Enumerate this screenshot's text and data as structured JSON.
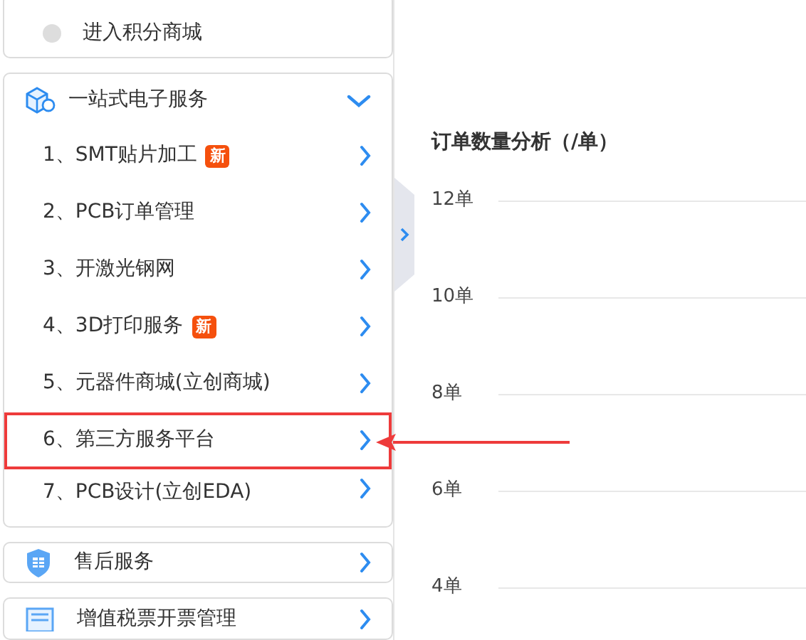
{
  "points_card": {
    "label": "进入积分商城"
  },
  "service_panel": {
    "title": "一站式电子服务",
    "expanded": true,
    "items": [
      {
        "label": "1、SMT贴片加工",
        "badge": "新",
        "highlighted": false
      },
      {
        "label": "2、PCB订单管理",
        "highlighted": false
      },
      {
        "label": "3、开激光钢网",
        "highlighted": false
      },
      {
        "label": "4、3D打印服务",
        "badge": "新",
        "highlighted": false
      },
      {
        "label": "5、元器件商城(立创商城)",
        "highlighted": false
      },
      {
        "label": "6、第三方服务平台",
        "highlighted": true
      },
      {
        "label": "7、PCB设计(立创EDA)",
        "highlighted": false
      }
    ]
  },
  "menu_cards": [
    {
      "kind": "after-sales",
      "label": "售后服务"
    },
    {
      "kind": "invoice",
      "label": "增值税票开票管理"
    }
  ],
  "order_chart": {
    "title": "订单数量分析（/单）",
    "y_labels": [
      "12单",
      "10单",
      "8单",
      "6单",
      "4单"
    ]
  }
}
